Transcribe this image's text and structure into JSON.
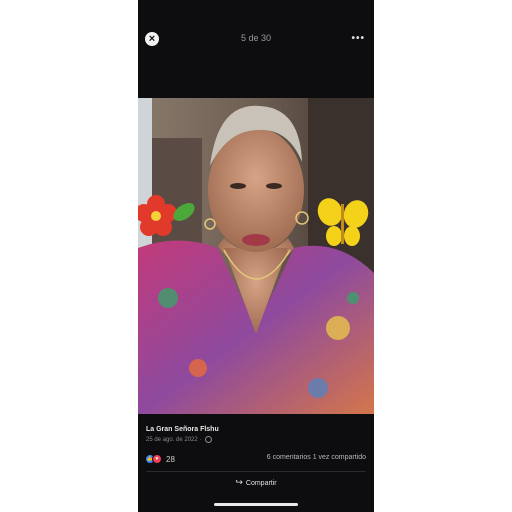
{
  "viewer": {
    "counter": "5 de 30",
    "close_icon": "close-icon",
    "more_label": "•••"
  },
  "post": {
    "author": "La Gran Señora Flshu",
    "date": "25 de ago. de 2022",
    "privacy_icon": "globe-icon",
    "reaction_count": "28",
    "comments": "6 comentarios",
    "shares": "1 vez compartido",
    "share_label": "Compartir"
  }
}
